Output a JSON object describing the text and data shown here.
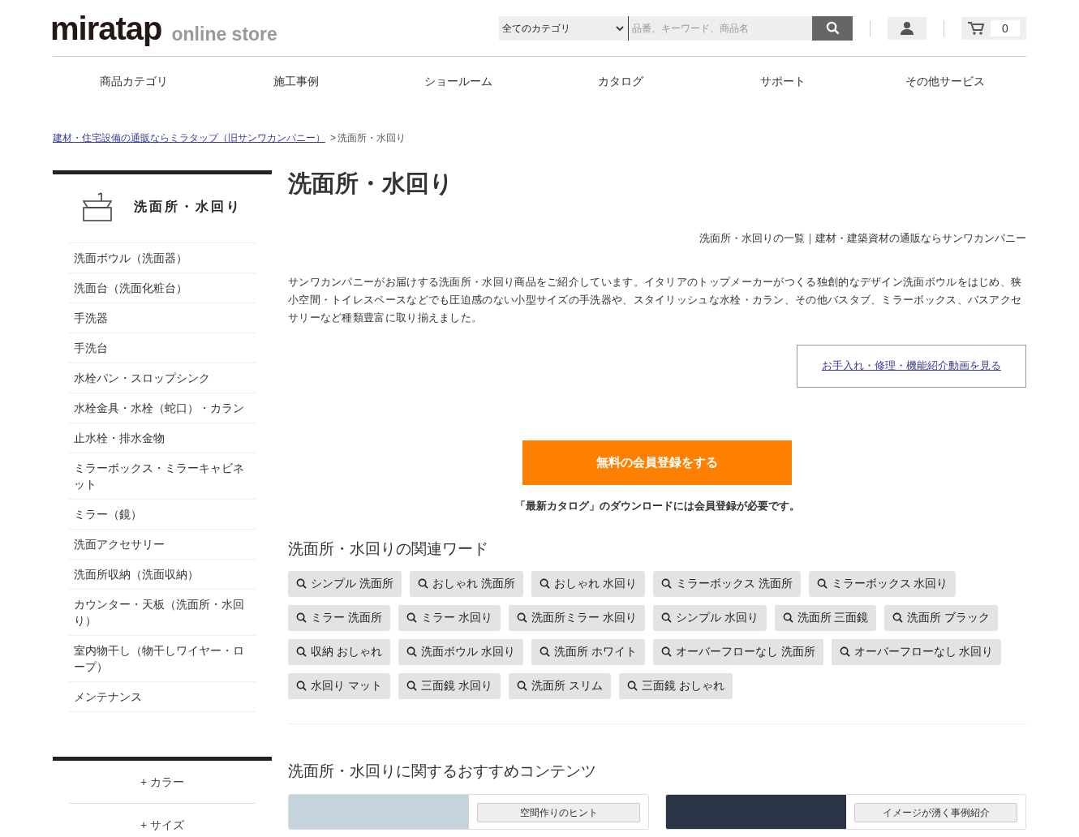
{
  "header": {
    "logo": {
      "brand": "miratap",
      "tagline": "online store"
    },
    "search": {
      "category": "全てのカテゴリ",
      "placeholder": "品番、キーワード、商品名"
    },
    "cart_count": "0"
  },
  "nav": [
    "商品カテゴリ",
    "施工事例",
    "ショールーム",
    "カタログ",
    "サポート",
    "その他サービス"
  ],
  "breadcrumb": [
    {
      "label": "建材・住宅設備の通販ならミラタップ（旧サンワカンパニー）",
      "kind": "link"
    },
    {
      "label": ">",
      "kind": "separator"
    },
    {
      "label": "洗面所・水回り",
      "kind": "current"
    }
  ],
  "sidebar": {
    "title": "洗面所・水回り",
    "items": [
      "洗面ボウル（洗面器）",
      "洗面台（洗面化粧台）",
      "手洗器",
      "手洗台",
      "水栓パン・スロップシンク",
      "水栓金具・水栓（蛇口）・カラン",
      "止水栓・排水金物",
      "ミラーボックス・ミラーキャビネット",
      "ミラー（鏡）",
      "洗面アクセサリー",
      "洗面所収納（洗面収納）",
      "カウンター・天板（洗面所・水回り）",
      "室内物干し（物干しワイヤー・ロープ）",
      "メンテナンス"
    ],
    "filters": [
      "+ カラー",
      "+ サイズ"
    ]
  },
  "main": {
    "title": "洗面所・水回り",
    "subtitle": "洗面所・水回りの一覧｜建材・建築資材の通販ならサンワカンパニー",
    "description": "サンワカンパニーがお届けする洗面所・水回り商品をご紹介しています。イタリアのトップメーカーがつくる独創的なデザイン洗面ボウルをはじめ、狭小空間・トイレスペースなどでも圧迫感のない小型サイズの手洗器や、スタイリッシュな水栓・カラン、その他バスタブ、ミラーボックス、バスアクセサリーなど種類豊富に取り揃えました。",
    "video_link": "お手入れ・修理・機能紹介動画を見る",
    "register_button": "無料の会員登録をする",
    "register_note": "「最新カタログ」のダウンロードには会員登録が必要です。",
    "related_title": "洗面所・水回りの関連ワード",
    "tags": [
      "シンプル 洗面所",
      "おしゃれ 洗面所",
      "おしゃれ 水回り",
      "ミラーボックス 洗面所",
      "ミラーボックス 水回り",
      "ミラー 洗面所",
      "ミラー 水回り",
      "洗面所ミラー 水回り",
      "シンプル 水回り",
      "洗面所 三面鏡",
      "洗面所 ブラック",
      "収納 おしゃれ",
      "洗面ボウル 水回り",
      "洗面所 ホワイト",
      "オーバーフローなし 洗面所",
      "オーバーフローなし 水回り",
      "水回り マット",
      "三面鏡 水回り",
      "洗面所 スリム",
      "三面鏡 おしゃれ"
    ],
    "recommend_title": "洗面所・水回りに関するおすすめコンテンツ",
    "cards": [
      {
        "label": "空間作りのヒント"
      },
      {
        "label": "イメージが湧く事例紹介"
      }
    ]
  }
}
